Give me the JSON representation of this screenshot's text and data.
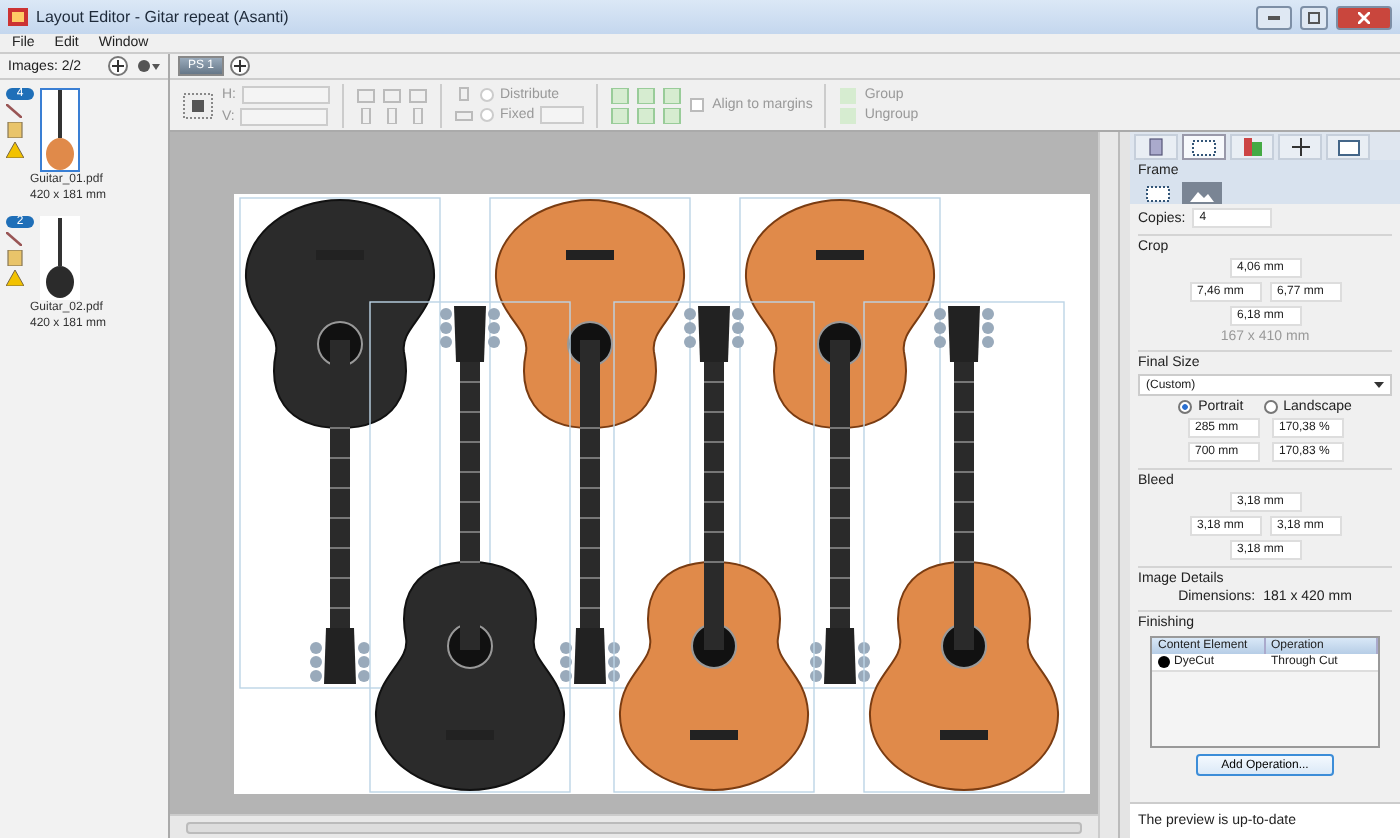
{
  "window": {
    "title": "Layout Editor - Gitar repeat (Asanti)"
  },
  "menu": [
    "File",
    "Edit",
    "Window"
  ],
  "images": {
    "label": "Images: 2/2",
    "items": [
      {
        "copies": "4",
        "name": "Guitar_01.pdf",
        "size": "420 x 181 mm",
        "selected": true
      },
      {
        "copies": "2",
        "name": "Guitar_02.pdf",
        "size": "420 x 181 mm",
        "selected": false
      }
    ]
  },
  "doc_tabs": [
    {
      "label": "PS 1",
      "selected": true
    }
  ],
  "toolbar": {
    "disabled": true,
    "h_label": "H:",
    "v_label": "V:",
    "distribute": {
      "label": "Distribute",
      "checked": false
    },
    "fixed": {
      "label": "Fixed",
      "checked": false
    },
    "align_to_margins": {
      "label": "Align to margins",
      "checked": false
    },
    "group": "Group",
    "ungroup": "Ungroup"
  },
  "inspector": {
    "tabs": [
      {
        "kind": "document",
        "selected": false
      },
      {
        "kind": "frame",
        "selected": true
      },
      {
        "kind": "color",
        "selected": false
      },
      {
        "kind": "position",
        "selected": false
      },
      {
        "kind": "view",
        "selected": false
      }
    ],
    "section_title": "Frame",
    "subtabs": [
      {
        "kind": "frame",
        "selected": false
      },
      {
        "kind": "image",
        "selected": true
      }
    ],
    "copies": {
      "label": "Copies:",
      "value": "4"
    },
    "crop": {
      "title": "Crop",
      "top": "4,06 mm",
      "left": "7,46 mm",
      "right": "6,77 mm",
      "bottom": "6,18 mm",
      "result": "167 x 410 mm"
    },
    "final_size": {
      "title": "Final Size",
      "preset": "(Custom)",
      "orientation": [
        {
          "label": "Portrait",
          "selected": true
        },
        {
          "label": "Landscape",
          "selected": false
        }
      ],
      "width": "285 mm",
      "width_pct": "170,38 %",
      "height": "700 mm",
      "height_pct": "170,83 %"
    },
    "bleed": {
      "title": "Bleed",
      "top": "3,18 mm",
      "left": "3,18 mm",
      "right": "3,18 mm",
      "bottom": "3,18 mm"
    },
    "image_details": {
      "title": "Image Details",
      "label": "Dimensions:",
      "value": "181 x 420 mm"
    },
    "finishing": {
      "title": "Finishing",
      "columns": [
        "Content Element",
        "Operation"
      ],
      "rows": [
        {
          "element": "DyeCut",
          "operation": "Through Cut",
          "color": "#000000"
        }
      ],
      "button": "Add Operation..."
    },
    "status": "The preview is up-to-date"
  }
}
